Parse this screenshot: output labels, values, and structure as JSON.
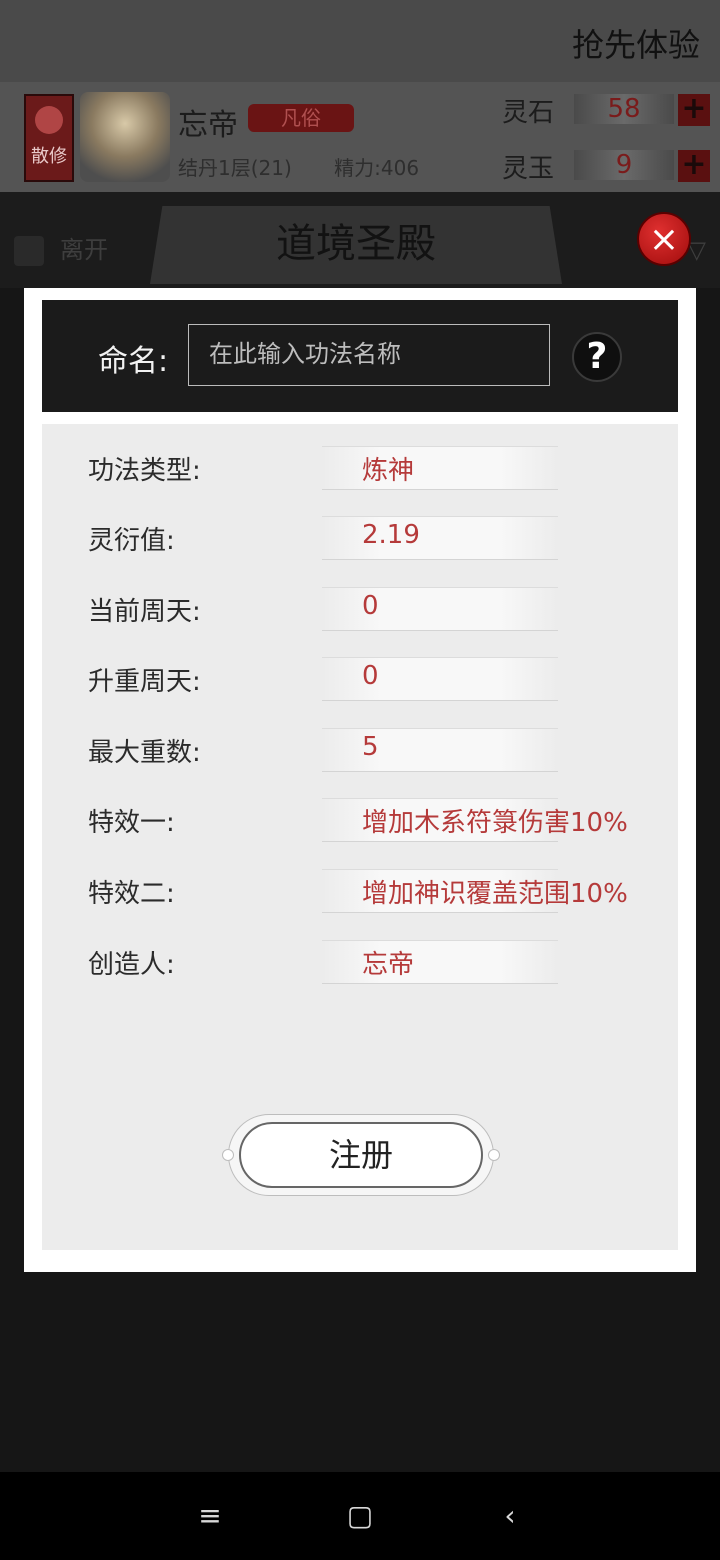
{
  "top_bar": {
    "promo": "抢先体验"
  },
  "player": {
    "rank_badge": "散修",
    "name": "忘帝",
    "realm": "凡俗",
    "cultivation": "结丹1层(21)",
    "energy": "精力:406"
  },
  "currencies": [
    {
      "label": "灵石",
      "value": "58",
      "add": "+"
    },
    {
      "label": "灵玉",
      "value": "9",
      "add": "+"
    }
  ],
  "nav": {
    "back_label": "离开",
    "title": "道境圣殿",
    "filter_label": "筛"
  },
  "dialog": {
    "close_icon": "×",
    "name_label": "命名:",
    "name_placeholder": "在此输入功法名称",
    "name_value": "",
    "help_icon": "?",
    "properties": [
      {
        "label": "功法类型:",
        "value": "炼神"
      },
      {
        "label": "灵衍值:",
        "value": "2.19"
      },
      {
        "label": "当前周天:",
        "value": "0"
      },
      {
        "label": "升重周天:",
        "value": "0"
      },
      {
        "label": "最大重数:",
        "value": "5"
      },
      {
        "label": "特效一:",
        "value": "增加木系符箓伤害10%"
      },
      {
        "label": "特效二:",
        "value": "增加神识覆盖范围10%"
      },
      {
        "label": "创造人:",
        "value": "忘帝"
      }
    ],
    "register_label": "注册"
  },
  "system_nav": {
    "menu_icon": "≡",
    "home_icon": "▢",
    "back_icon": "‹"
  },
  "colors": {
    "accent_red": "#b53a3a",
    "overlay_dark": "#161616",
    "close_red": "#d02020"
  }
}
